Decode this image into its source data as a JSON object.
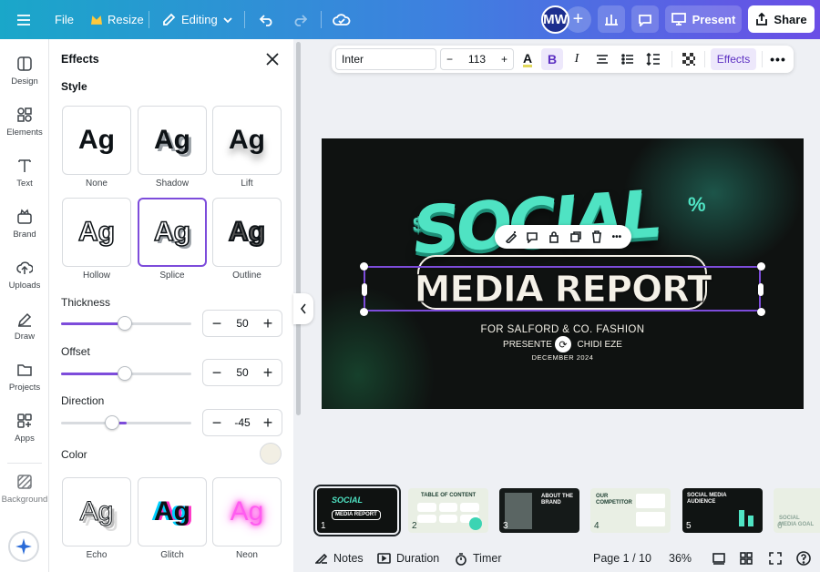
{
  "topbar": {
    "menu_icon": "hamburger-icon",
    "file": "File",
    "resize": "Resize",
    "editing": "Editing",
    "avatar_initials": "MW",
    "present": "Present",
    "share": "Share"
  },
  "rail": {
    "items": [
      {
        "label": "Design",
        "icon": "layout-icon"
      },
      {
        "label": "Elements",
        "icon": "shapes-icon"
      },
      {
        "label": "Text",
        "icon": "text-icon"
      },
      {
        "label": "Brand",
        "icon": "brand-icon"
      },
      {
        "label": "Uploads",
        "icon": "upload-cloud-icon"
      },
      {
        "label": "Draw",
        "icon": "pen-icon"
      },
      {
        "label": "Projects",
        "icon": "folder-icon"
      },
      {
        "label": "Apps",
        "icon": "apps-icon"
      },
      {
        "label": "Background",
        "icon": "background-icon"
      }
    ]
  },
  "panel": {
    "title": "Effects",
    "style_heading": "Style",
    "styles": [
      "None",
      "Shadow",
      "Lift",
      "Hollow",
      "Splice",
      "Outline"
    ],
    "selected_style": "Splice",
    "sample_text": "Ag",
    "thickness_label": "Thickness",
    "thickness_value": "50",
    "offset_label": "Offset",
    "offset_value": "50",
    "direction_label": "Direction",
    "direction_value": "-45",
    "color_label": "Color",
    "color_value": "#f2efe4",
    "more_styles": [
      "Echo",
      "Glitch",
      "Neon"
    ]
  },
  "text_toolbar": {
    "font": "Inter",
    "size": "113",
    "effects": "Effects"
  },
  "slide": {
    "social": "SOCIAL",
    "title": "MEDIA REPORT",
    "line1": "FOR SALFORD & CO. FASHION",
    "line2_left": "PRESENTE",
    "line2_right": "CHIDI EZE",
    "line3": "DECEMBER 2024"
  },
  "thumbnails": [
    {
      "num": "1",
      "title": "SOCIAL MEDIA REPORT"
    },
    {
      "num": "2",
      "title": "TABLE OF CONTENT"
    },
    {
      "num": "3",
      "title": "ABOUT THE BRAND"
    },
    {
      "num": "4",
      "title": "OUR COMPETITOR"
    },
    {
      "num": "5",
      "title": "SOCIAL MEDIA AUDIENCE"
    },
    {
      "num": "6",
      "title": "SOCIAL MEDIA GOAL"
    }
  ],
  "footer": {
    "notes": "Notes",
    "duration": "Duration",
    "timer": "Timer",
    "page": "Page 1 / 10",
    "zoom": "36%"
  }
}
